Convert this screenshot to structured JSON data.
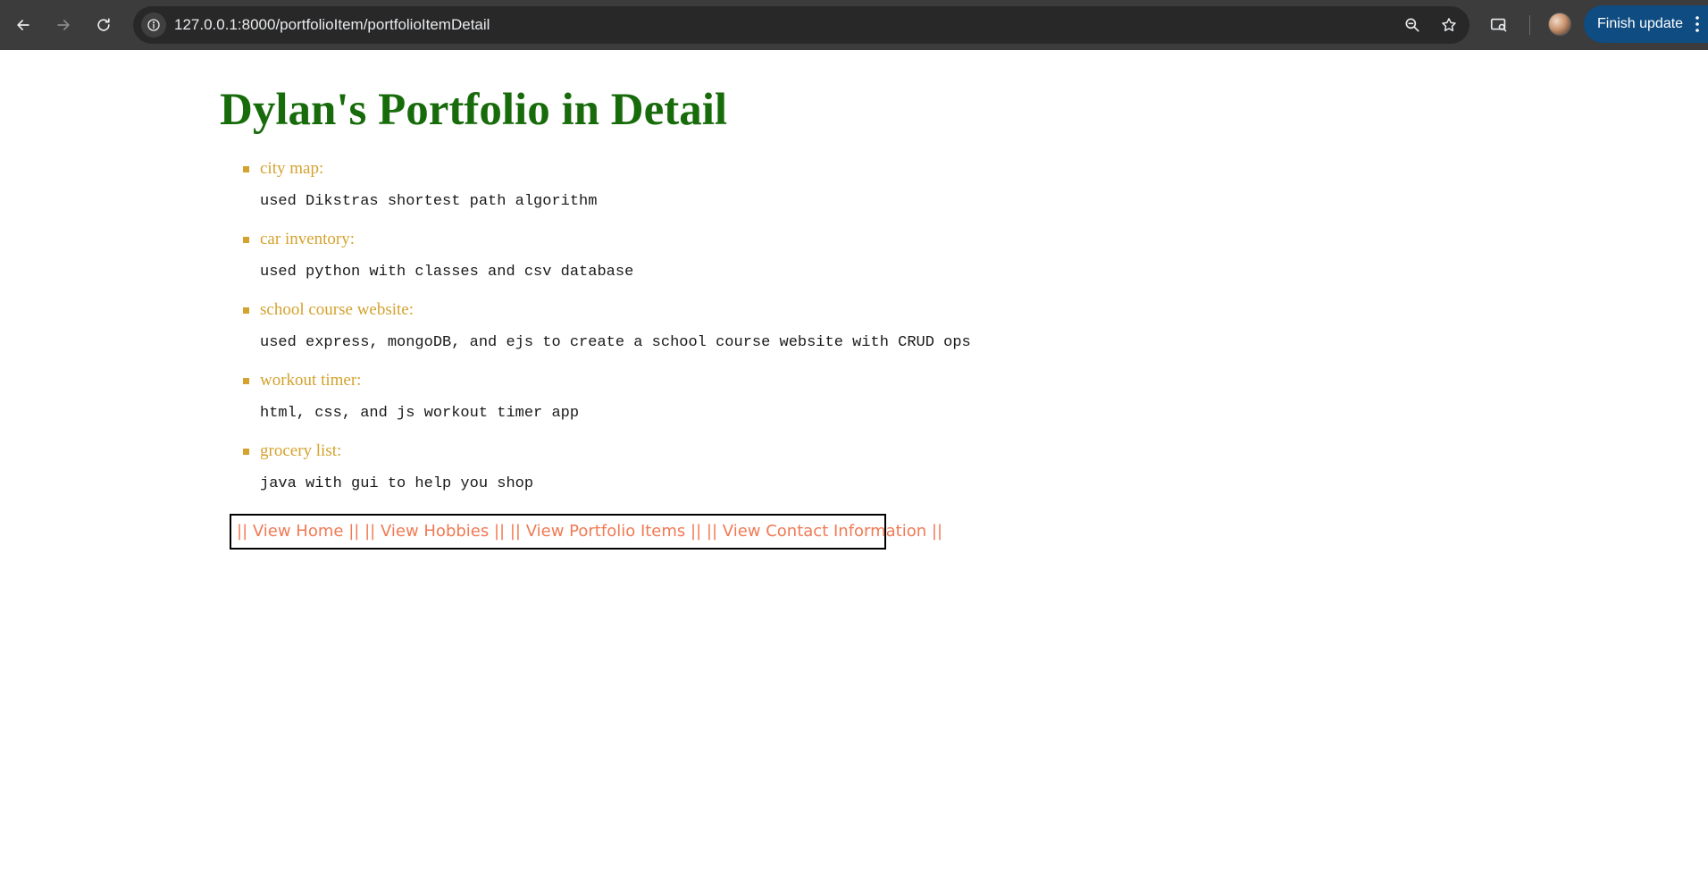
{
  "browser": {
    "url": "127.0.0.1:8000/portfolioItem/portfolioItemDetail",
    "update_label": "Finish update"
  },
  "page": {
    "title": "Dylan's Portfolio in Detail",
    "items": [
      {
        "name": "city map:",
        "description": "used Dikstras shortest path algorithm"
      },
      {
        "name": "car inventory:",
        "description": "used python with classes and csv database"
      },
      {
        "name": "school course website:",
        "description": "used express, mongoDB, and ejs to create a school course website with CRUD ops"
      },
      {
        "name": "workout timer:",
        "description": "html, css, and js workout timer app"
      },
      {
        "name": "grocery list:",
        "description": "java with gui to help you shop"
      }
    ],
    "nav": {
      "separator": "||",
      "links": [
        "View Home",
        "View Hobbies",
        "View Portfolio Items",
        "View Contact Information"
      ]
    }
  },
  "colors": {
    "title": "#176b0a",
    "item_name": "#d4a22e",
    "nav_link": "#f07a55",
    "update_button": "#0f4c81"
  }
}
